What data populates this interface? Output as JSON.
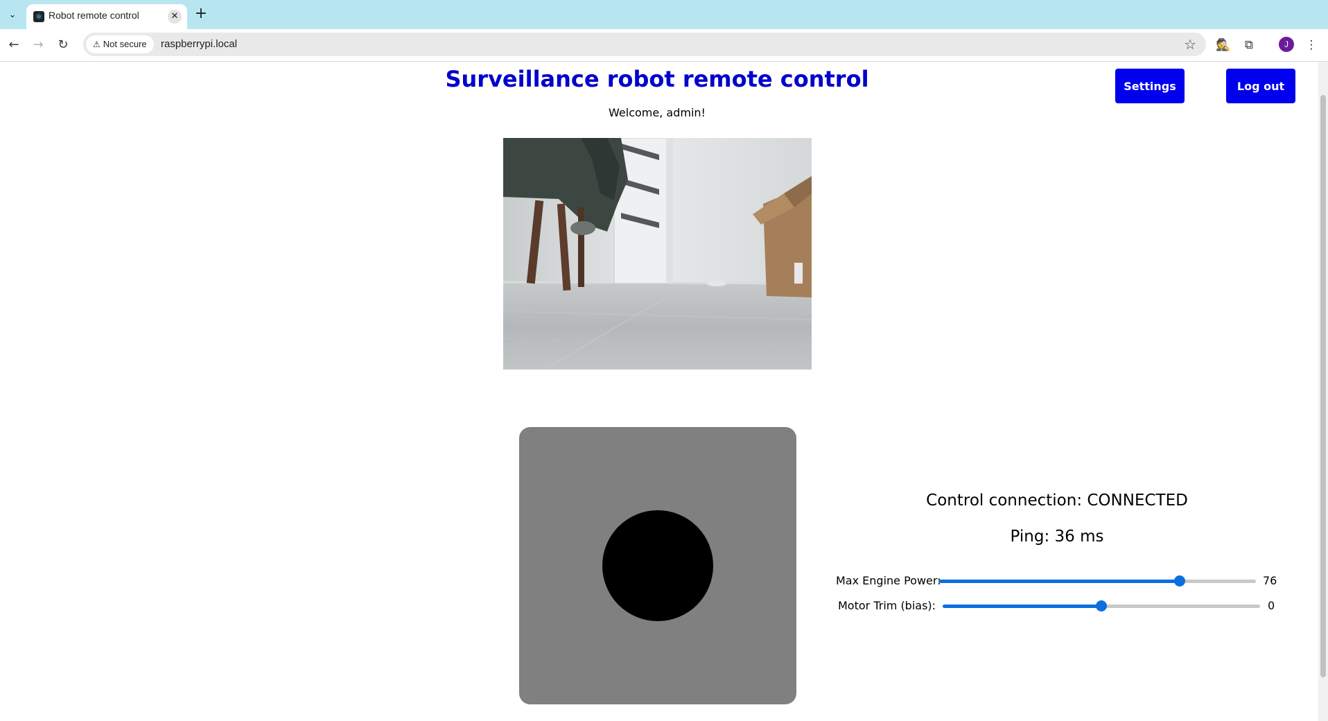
{
  "browser": {
    "tab_title": "Robot remote control",
    "security_label": "Not secure",
    "url": "raspberrypi.local",
    "profile_initial": "J"
  },
  "header": {
    "title": "Surveillance robot remote control",
    "welcome": "Welcome, admin!",
    "settings_label": "Settings",
    "logout_label": "Log out"
  },
  "status": {
    "connection": "Control connection: CONNECTED",
    "ping": "Ping: 36 ms"
  },
  "sliders": {
    "max_power": {
      "label": "Max Engine Power:",
      "value": "76",
      "fraction": 0.76
    },
    "motor_trim": {
      "label": "Motor Trim (bias):",
      "value": "0",
      "fraction": 0.5
    }
  },
  "colors": {
    "title": "#0000cc",
    "button": "#0000ee",
    "slider_accent": "#0b6fe0",
    "joystick_pad": "#808080",
    "joystick_stick": "#000000"
  }
}
